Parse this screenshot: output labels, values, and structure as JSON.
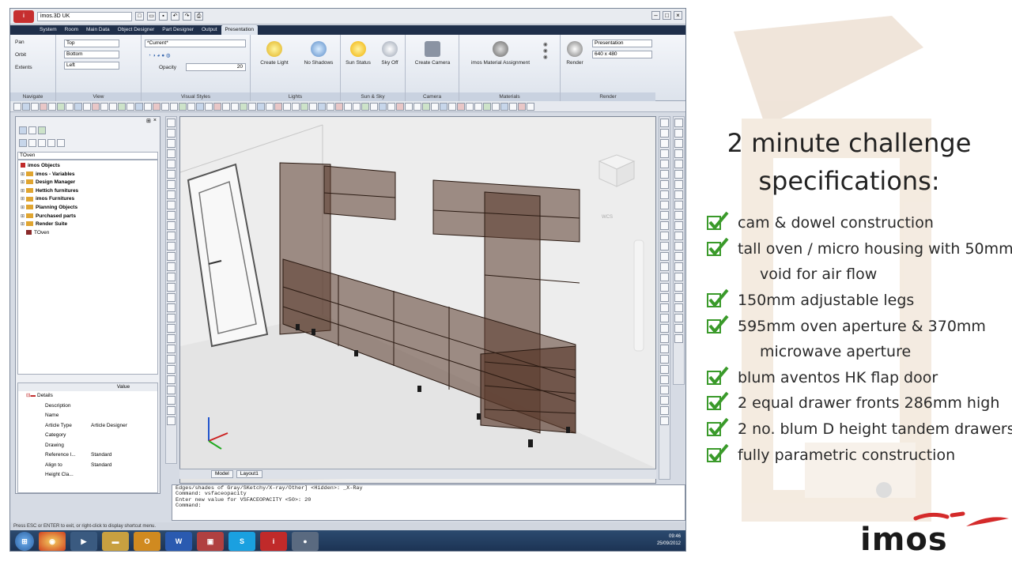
{
  "app": {
    "title": "imos.3D UK",
    "tabs": [
      "System",
      "Room",
      "Main Data",
      "Object Designer",
      "Part Designer",
      "Output",
      "Presentation"
    ],
    "active_tab": "Presentation",
    "navigate": {
      "items": [
        "Pan",
        "Orbit",
        "Extents"
      ],
      "label": "Navigate"
    },
    "view": {
      "items": [
        "Top",
        "Bottom",
        "Left"
      ],
      "label": "View"
    },
    "visual_styles": {
      "current": "*Current*",
      "opacity_label": "Opacity",
      "opacity_value": "20",
      "label": "Visual Styles"
    },
    "lights": {
      "buttons": [
        "Create Light",
        "No Shadows"
      ],
      "label": "Lights"
    },
    "sun_sky": {
      "buttons": [
        "Sun Status",
        "Sky Off"
      ],
      "label": "Sun & Sky"
    },
    "camera": {
      "buttons": [
        "Create Camera"
      ],
      "label": "Camera"
    },
    "materials": {
      "buttons": [
        "imos Material Assignment"
      ],
      "label": "Materials"
    },
    "render": {
      "button": "Render",
      "preset": "Presentation",
      "size": "640 x 480",
      "label": "Render"
    },
    "left_panel": {
      "search": "TOven",
      "tree": [
        "imos Objects",
        "imos - Variables",
        "Design Manager",
        "Hettich furnitures",
        "imos Furnitures",
        "Planning Objects",
        "Purchased parts",
        "Render Suite",
        "TOven"
      ],
      "props_header": "Value",
      "props": [
        {
          "k": "Details",
          "v": ""
        },
        {
          "k": "Description",
          "v": ""
        },
        {
          "k": "Name",
          "v": ""
        },
        {
          "k": "Article Type",
          "v": "Article Designer"
        },
        {
          "k": "Category",
          "v": ""
        },
        {
          "k": "Drawing",
          "v": ""
        },
        {
          "k": "Reference l...",
          "v": "Standard"
        },
        {
          "k": "Align to",
          "v": "Standard"
        },
        {
          "k": "Height Cla...",
          "v": ""
        }
      ]
    },
    "viewport_tabs": [
      "Model",
      "Layout1"
    ],
    "compass": "WCS",
    "command_lines": [
      "Edges/shades of Gray/SKetchy/X-ray/Other] <Hidden>: _X-Ray",
      "Command: vsfaceopacity",
      "Enter new value for VSFACEOPACITY <50>: 20",
      "Command:"
    ],
    "status_text": "Press ESC or ENTER to exit, or right-click to display shortcut menu.",
    "clock_time": "09:46",
    "clock_date": "25/09/2012"
  },
  "slide": {
    "heading_line1": "2 minute challenge",
    "heading_line2": "specifications:",
    "specs": [
      {
        "text": "cam & dowel construction",
        "cont": ""
      },
      {
        "text": "tall oven / micro housing with 50mm",
        "cont": "void for air flow"
      },
      {
        "text": "150mm adjustable legs",
        "cont": ""
      },
      {
        "text": "595mm oven aperture & 370mm",
        "cont": "microwave aperture"
      },
      {
        "text": "blum aventos HK flap door",
        "cont": ""
      },
      {
        "text": "2 equal drawer fronts 286mm high",
        "cont": ""
      },
      {
        "text": "2 no. blum D height tandem drawers",
        "cont": ""
      },
      {
        "text": "fully parametric construction",
        "cont": ""
      }
    ],
    "brand": "imos",
    "colors": {
      "check": "#3a9a2a",
      "brand_red": "#d42a2a",
      "accent": "#c62f2f"
    }
  }
}
